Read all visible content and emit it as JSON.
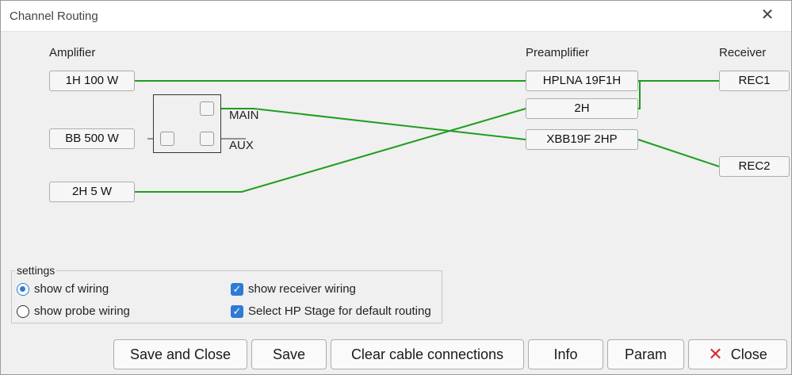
{
  "window": {
    "title": "Channel Routing"
  },
  "columns": {
    "amplifier": "Amplifier",
    "preamplifier": "Preamplifier",
    "receiver": "Receiver"
  },
  "amplifiers": [
    "1H 100 W",
    "BB 500 W",
    "2H 5 W"
  ],
  "preamplifiers": [
    "HPLNA 19F1H",
    "2H",
    "XBB19F 2HP"
  ],
  "receivers": [
    "REC1",
    "REC2"
  ],
  "switch": {
    "main": "MAIN",
    "aux": "AUX"
  },
  "settings": {
    "legend": "settings",
    "show_cf_wiring": "show cf wiring",
    "show_probe_wiring": "show probe wiring",
    "show_receiver_wiring": "show receiver wiring",
    "select_hp_stage": "Select HP Stage for default routing",
    "selected_radio": "show cf wiring",
    "show_receiver_wiring_checked": true,
    "select_hp_stage_checked": true
  },
  "buttons": {
    "save_close": "Save and Close",
    "save": "Save",
    "clear": "Clear cable connections",
    "info": "Info",
    "param": "Param",
    "close": "Close"
  },
  "colors": {
    "wire": "#1f9d1f",
    "accent": "#2e7bd6",
    "close_icon": "#d32f2f"
  }
}
